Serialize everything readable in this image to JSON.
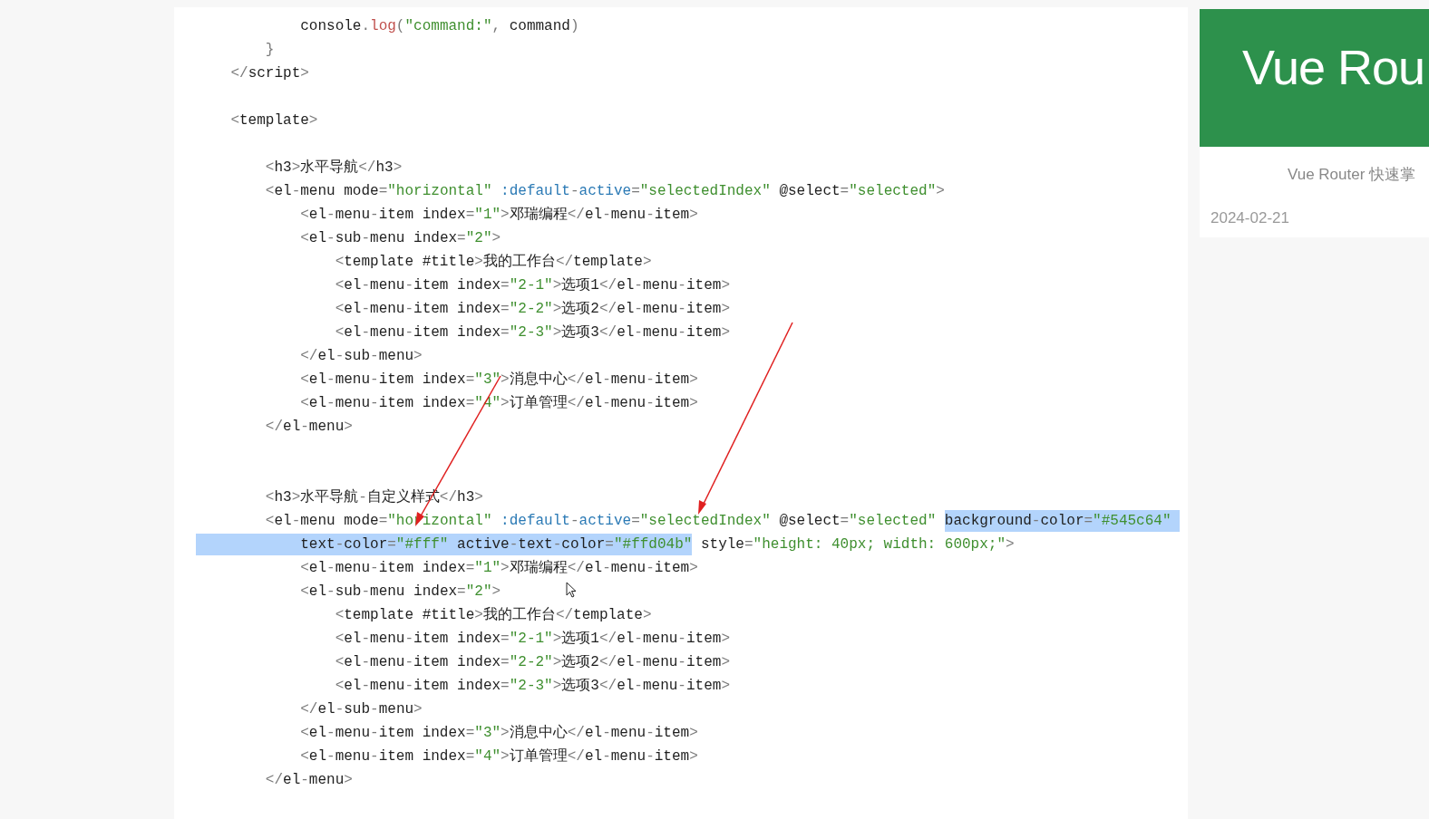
{
  "code_lines": [
    {
      "kind": "code",
      "segments": [
        {
          "text": "            console.log(\"command:\", command)",
          "highlighted": false
        }
      ]
    },
    {
      "kind": "code",
      "segments": [
        {
          "text": "        }",
          "highlighted": false
        }
      ]
    },
    {
      "kind": "code",
      "segments": [
        {
          "text": "    </script>",
          "highlighted": false
        }
      ]
    },
    {
      "kind": "blank"
    },
    {
      "kind": "code",
      "segments": [
        {
          "text": "    <template>",
          "highlighted": false
        }
      ]
    },
    {
      "kind": "blank"
    },
    {
      "kind": "code",
      "segments": [
        {
          "text": "        <h3>水平导航</h3>",
          "highlighted": false
        }
      ]
    },
    {
      "kind": "code",
      "segments": [
        {
          "text": "        <el-menu mode=\"horizontal\" :default-active=\"selectedIndex\" @select=\"selected\">",
          "highlighted": false
        }
      ]
    },
    {
      "kind": "code",
      "segments": [
        {
          "text": "            <el-menu-item index=\"1\">邓瑞编程</el-menu-item>",
          "highlighted": false
        }
      ]
    },
    {
      "kind": "code",
      "segments": [
        {
          "text": "            <el-sub-menu index=\"2\">",
          "highlighted": false
        }
      ]
    },
    {
      "kind": "code",
      "segments": [
        {
          "text": "                <template #title>我的工作台</template>",
          "highlighted": false
        }
      ]
    },
    {
      "kind": "code",
      "segments": [
        {
          "text": "                <el-menu-item index=\"2-1\">选项1</el-menu-item>",
          "highlighted": false
        }
      ]
    },
    {
      "kind": "code",
      "segments": [
        {
          "text": "                <el-menu-item index=\"2-2\">选项2</el-menu-item>",
          "highlighted": false
        }
      ]
    },
    {
      "kind": "code",
      "segments": [
        {
          "text": "                <el-menu-item index=\"2-3\">选项3</el-menu-item>",
          "highlighted": false
        }
      ]
    },
    {
      "kind": "code",
      "segments": [
        {
          "text": "            </el-sub-menu>",
          "highlighted": false
        }
      ]
    },
    {
      "kind": "code",
      "segments": [
        {
          "text": "            <el-menu-item index=\"3\">消息中心</el-menu-item>",
          "highlighted": false
        }
      ]
    },
    {
      "kind": "code",
      "segments": [
        {
          "text": "            <el-menu-item index=\"4\">订单管理</el-menu-item>",
          "highlighted": false
        }
      ]
    },
    {
      "kind": "code",
      "segments": [
        {
          "text": "        </el-menu>",
          "highlighted": false
        }
      ]
    },
    {
      "kind": "blank"
    },
    {
      "kind": "blank"
    },
    {
      "kind": "code",
      "segments": [
        {
          "text": "        <h3>水平导航-自定义样式</h3>",
          "highlighted": false
        }
      ]
    },
    {
      "kind": "code",
      "segments": [
        {
          "text": "        <el-menu mode=\"horizontal\" :default-active=\"selectedIndex\" @select=\"selected\" ",
          "highlighted": false
        },
        {
          "text": "background-color=\"#545c64\" ",
          "highlighted": true
        }
      ]
    },
    {
      "kind": "code",
      "segments": [
        {
          "text": "            text-color=\"#fff\" active-text-color=\"#ffd04b\"",
          "highlighted": true
        },
        {
          "text": " style=\"height: 40px; width: 600px;\">",
          "highlighted": false
        }
      ]
    },
    {
      "kind": "code",
      "segments": [
        {
          "text": "            <el-menu-item index=\"1\">邓瑞编程</el-menu-item>",
          "highlighted": false
        }
      ]
    },
    {
      "kind": "code",
      "segments": [
        {
          "text": "            <el-sub-menu index=\"2\">",
          "highlighted": false
        }
      ]
    },
    {
      "kind": "code",
      "segments": [
        {
          "text": "                <template #title>我的工作台</template>",
          "highlighted": false
        }
      ]
    },
    {
      "kind": "code",
      "segments": [
        {
          "text": "                <el-menu-item index=\"2-1\">选项1</el-menu-item>",
          "highlighted": false
        }
      ]
    },
    {
      "kind": "code",
      "segments": [
        {
          "text": "                <el-menu-item index=\"2-2\">选项2</el-menu-item>",
          "highlighted": false
        }
      ]
    },
    {
      "kind": "code",
      "segments": [
        {
          "text": "                <el-menu-item index=\"2-3\">选项3</el-menu-item>",
          "highlighted": false
        }
      ]
    },
    {
      "kind": "code",
      "segments": [
        {
          "text": "            </el-sub-menu>",
          "highlighted": false
        }
      ]
    },
    {
      "kind": "code",
      "segments": [
        {
          "text": "            <el-menu-item index=\"3\">消息中心</el-menu-item>",
          "highlighted": false
        }
      ]
    },
    {
      "kind": "code",
      "segments": [
        {
          "text": "            <el-menu-item index=\"4\">订单管理</el-menu-item>",
          "highlighted": false
        }
      ]
    },
    {
      "kind": "code",
      "segments": [
        {
          "text": "        </el-menu>",
          "highlighted": false
        }
      ]
    }
  ],
  "article_card": {
    "cover_title": "Vue Rou",
    "title": "Vue Router 快速掌",
    "date": "2024-02-21"
  }
}
